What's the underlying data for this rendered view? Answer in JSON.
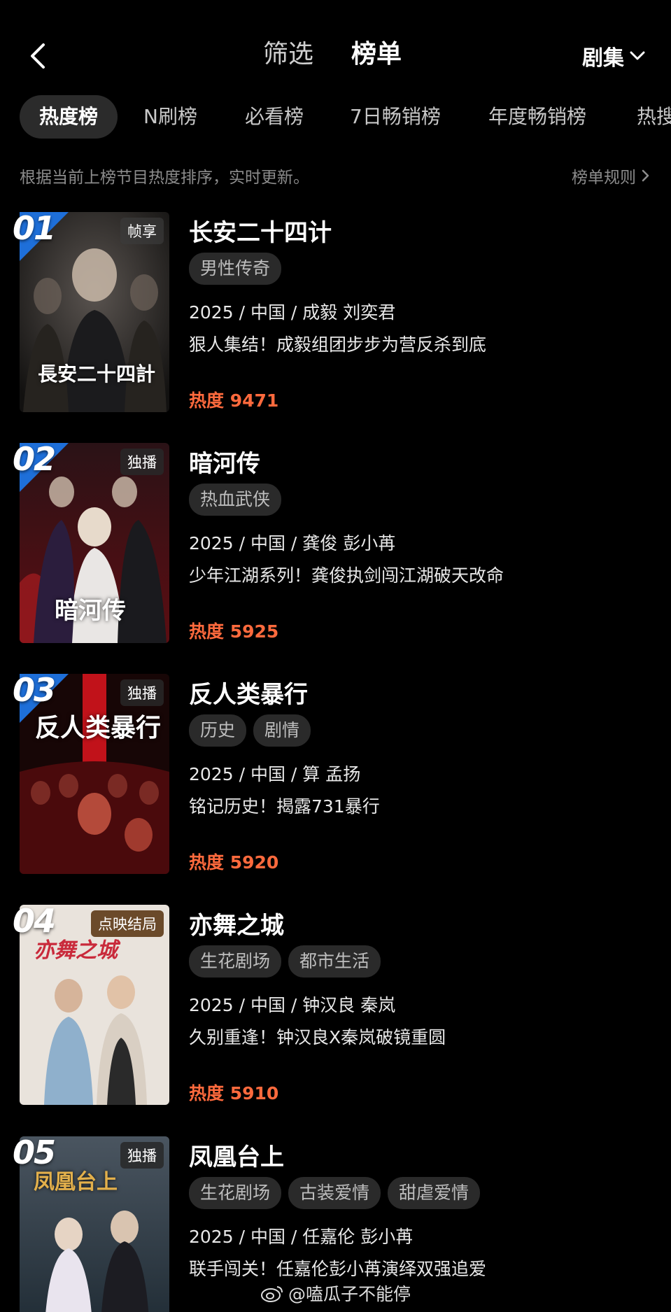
{
  "header": {
    "filter_label": "筛选",
    "ranking_label": "榜单",
    "category_label": "剧集"
  },
  "subtabs": [
    "热度榜",
    "N刷榜",
    "必看榜",
    "7日畅销榜",
    "年度畅销榜",
    "热搜"
  ],
  "description": "根据当前上榜节目热度排序，实时更新。",
  "rules_label": "榜单规则",
  "items": [
    {
      "rank": "01",
      "badge": "帧享",
      "poster_text": "長安二十四計",
      "title": "长安二十四计",
      "tags": [
        "男性传奇"
      ],
      "meta": "2025 / 中国 / 成毅 刘奕君",
      "slogan": "狠人集结！成毅组团步步为营反杀到底",
      "heat": "热度 9471"
    },
    {
      "rank": "02",
      "badge": "独播",
      "poster_text": "暗河传",
      "title": "暗河传",
      "tags": [
        "热血武侠"
      ],
      "meta": "2025 / 中国 / 龚俊 彭小苒",
      "slogan": "少年江湖系列！龚俊执剑闯江湖破天改命",
      "heat": "热度 5925"
    },
    {
      "rank": "03",
      "badge": "独播",
      "poster_text": "反人类暴行",
      "title": "反人类暴行",
      "tags": [
        "历史",
        "剧情"
      ],
      "meta": "2025 / 中国 / 算 孟扬",
      "slogan": "铭记历史！揭露731暴行",
      "heat": "热度 5920"
    },
    {
      "rank": "04",
      "badge": "点映结局",
      "poster_text": "亦舞之城",
      "title": "亦舞之城",
      "tags": [
        "生花剧场",
        "都市生活"
      ],
      "meta": "2025 / 中国 / 钟汉良 秦岚",
      "slogan": "久别重逢！钟汉良X秦岚破镜重圆",
      "heat": "热度 5910"
    },
    {
      "rank": "05",
      "badge": "独播",
      "poster_text": "凤凰台上",
      "title": "凤凰台上",
      "tags": [
        "生花剧场",
        "古装爱情",
        "甜虐爱情"
      ],
      "meta": "2025 / 中国 / 任嘉伦 彭小苒",
      "slogan": "联手闯关！任嘉伦彭小苒演绎双强追爱",
      "heat": ""
    }
  ],
  "watermark": "@嗑瓜子不能停",
  "colors": {
    "background": "#000000",
    "heat": "#ff6a3d",
    "rank_flag": "#1e6fd9",
    "tag_bg": "#2a2a2a"
  }
}
